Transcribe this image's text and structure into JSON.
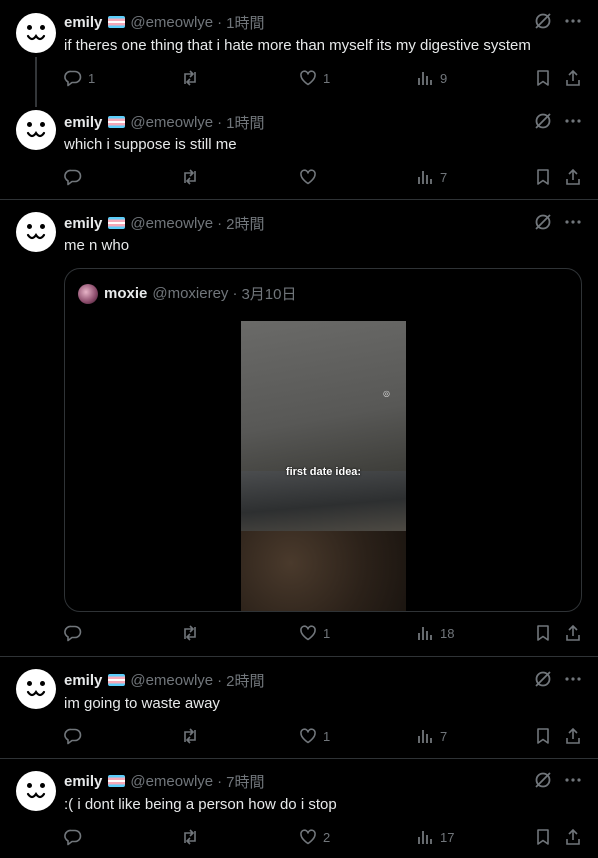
{
  "posts": [
    {
      "name": "emily",
      "handle": "@emeowlye",
      "time": "1時間",
      "text": "if theres one thing that i hate more than myself its my digestive system",
      "reply_count": "1",
      "repost_count": "",
      "like_count": "1",
      "view_count": "9"
    },
    {
      "name": "emily",
      "handle": "@emeowlye",
      "time": "1時間",
      "text": "which i suppose is still me",
      "reply_count": "",
      "repost_count": "",
      "like_count": "",
      "view_count": "7"
    },
    {
      "name": "emily",
      "handle": "@emeowlye",
      "time": "2時間",
      "text": "me n who",
      "reply_count": "",
      "repost_count": "",
      "like_count": "1",
      "view_count": "18"
    },
    {
      "name": "emily",
      "handle": "@emeowlye",
      "time": "2時間",
      "text": "im going to waste away",
      "reply_count": "",
      "repost_count": "",
      "like_count": "1",
      "view_count": "7"
    },
    {
      "name": "emily",
      "handle": "@emeowlye",
      "time": "7時間",
      "text": ":( i dont like being a person how do i stop",
      "reply_count": "",
      "repost_count": "",
      "like_count": "2",
      "view_count": "17"
    }
  ],
  "quote": {
    "name": "moxie",
    "handle": "@moxierey",
    "date": "3月10日",
    "video_caption": "first date idea:"
  },
  "separator": "·",
  "icons": {
    "reply": "reply-icon",
    "repost": "repost-icon",
    "like": "heart-icon",
    "views": "views-icon",
    "bookmark": "bookmark-icon",
    "share": "share-icon",
    "grok": "grok-icon",
    "more": "more-icon"
  },
  "colors": {
    "background": "#000000",
    "text": "#e7e9ea",
    "muted": "#71767b",
    "border": "#2f3336"
  }
}
